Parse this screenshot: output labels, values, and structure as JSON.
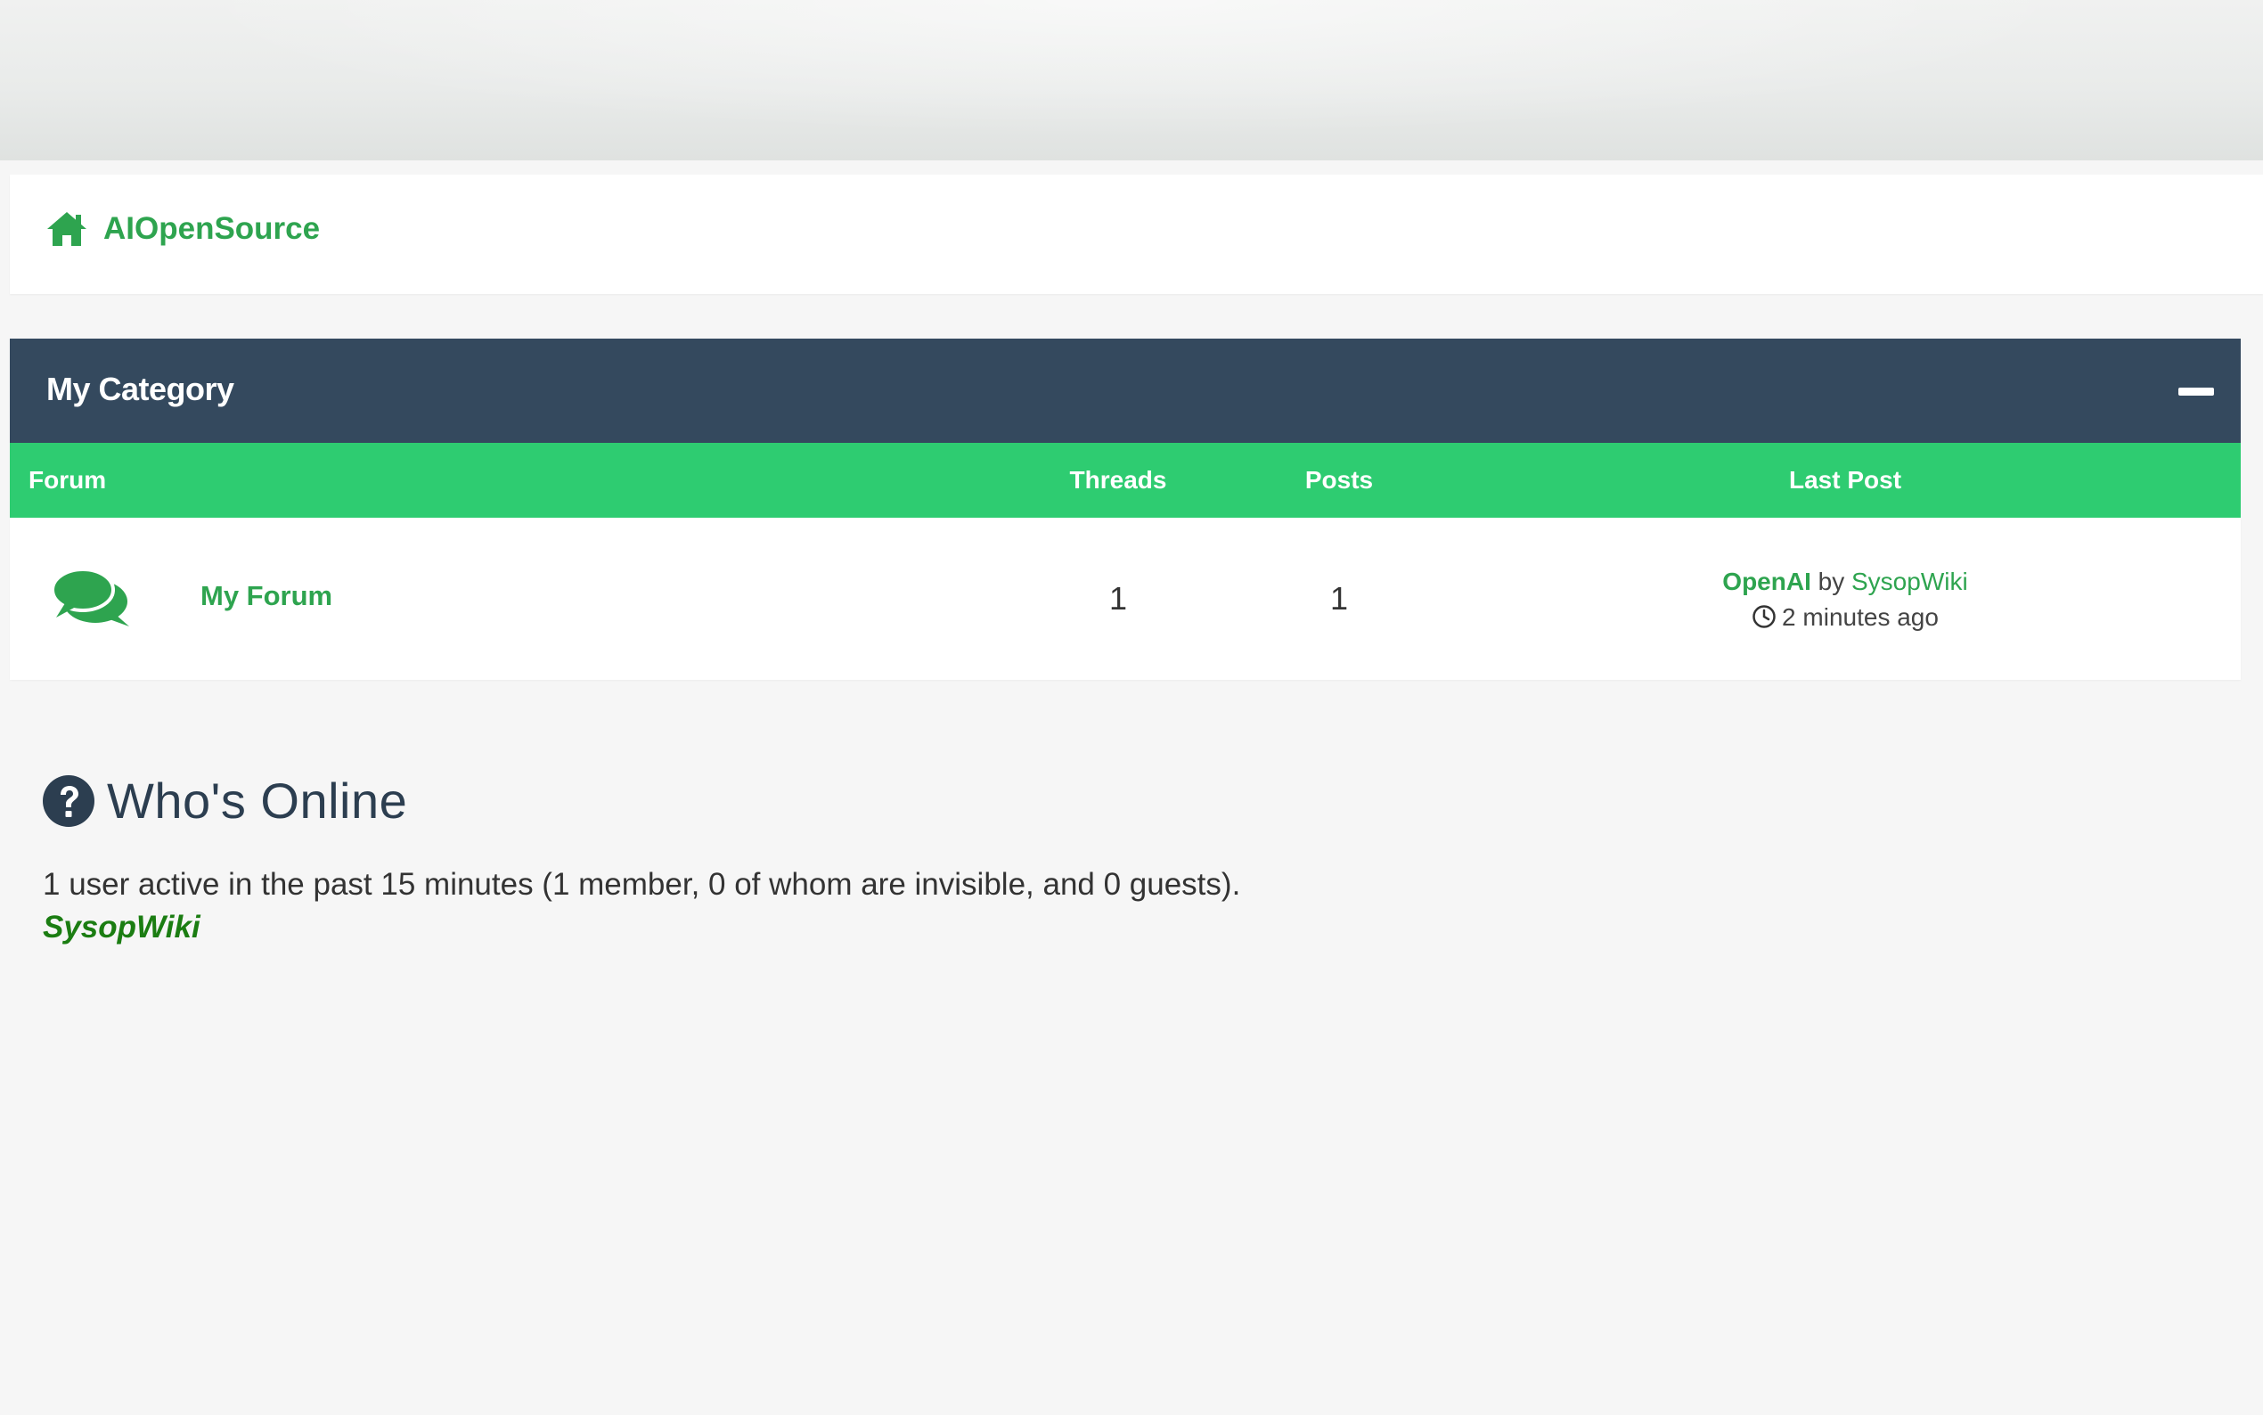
{
  "site": {
    "name": "AIOpenSource"
  },
  "category": {
    "title": "My Category",
    "columns": {
      "forum": "Forum",
      "threads": "Threads",
      "posts": "Posts",
      "last_post": "Last Post"
    },
    "forums": [
      {
        "name": "My Forum",
        "threads": "1",
        "posts": "1",
        "last_post": {
          "title": "OpenAI",
          "by": "by",
          "user": "SysopWiki",
          "time": "2 minutes ago"
        }
      }
    ]
  },
  "whos_online": {
    "title": "Who's Online",
    "stats": "1 user active in the past 15 minutes (1 member, 0 of whom are invisible, and 0 guests).",
    "users": [
      "SysopWiki"
    ]
  },
  "colors": {
    "accent_green": "#2ea44f",
    "header_green": "#2ecc71",
    "category_header": "#34495e",
    "online_user": "#1b7d12"
  },
  "icons": {
    "home": "home-icon",
    "forum": "comments-icon",
    "collapse": "minus-icon",
    "time": "clock-icon",
    "help": "question-circle-icon"
  }
}
